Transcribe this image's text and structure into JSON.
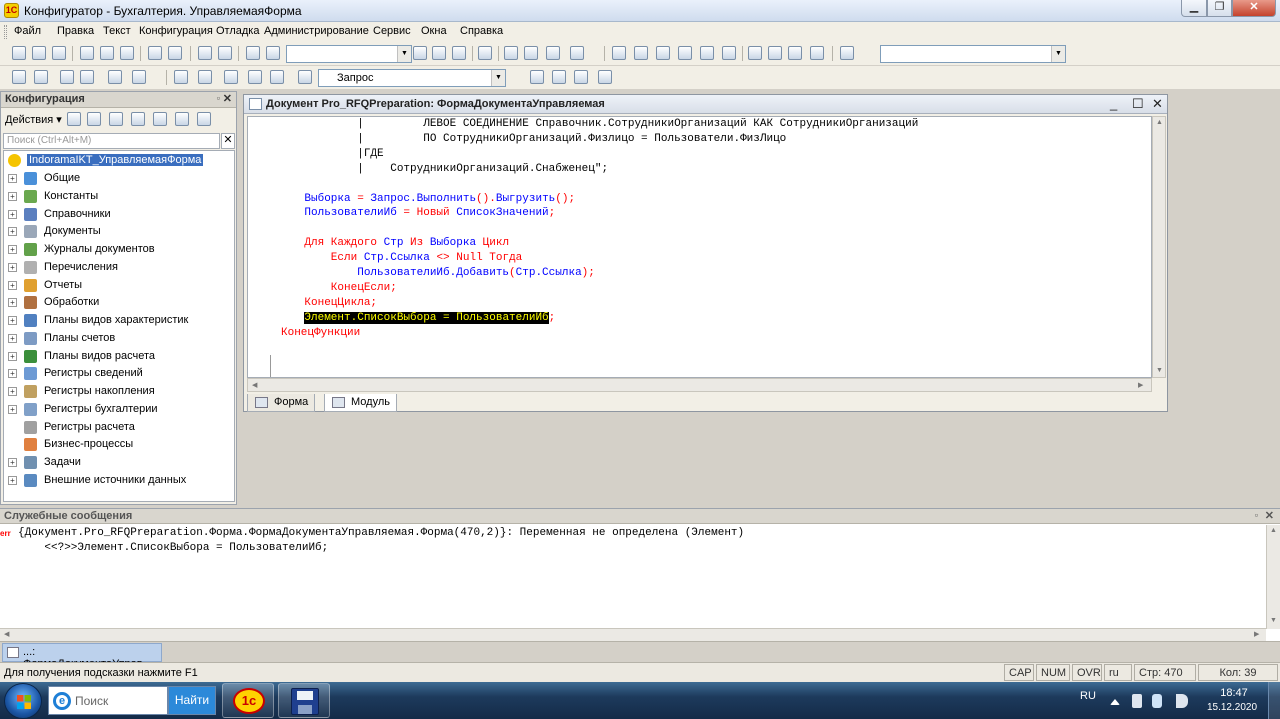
{
  "window": {
    "title": "Конфигуратор - Бухгалтерия. УправляемаяФорма"
  },
  "menu": [
    "Файл",
    "Правка",
    "Текст",
    "Конфигурация",
    "Отладка",
    "Администрирование",
    "Сервис",
    "Окна",
    "Справка"
  ],
  "toolbar": {
    "query_combo": "Запрос"
  },
  "config_panel": {
    "title": "Конфигурация",
    "actions_label": "Действия",
    "search_placeholder": "Поиск (Ctrl+Alt+M)",
    "root": "IndoramaIKT_УправляемаяФорма",
    "items": [
      {
        "label": "Общие",
        "icon": "shapes-icon"
      },
      {
        "label": "Константы",
        "icon": "constants-icon"
      },
      {
        "label": "Справочники",
        "icon": "catalog-icon"
      },
      {
        "label": "Документы",
        "icon": "document-icon"
      },
      {
        "label": "Журналы документов",
        "icon": "journal-icon"
      },
      {
        "label": "Перечисления",
        "icon": "enum-icon"
      },
      {
        "label": "Отчеты",
        "icon": "report-icon"
      },
      {
        "label": "Обработки",
        "icon": "processing-icon"
      },
      {
        "label": "Планы видов характеристик",
        "icon": "chart-types-icon"
      },
      {
        "label": "Планы счетов",
        "icon": "accounts-icon"
      },
      {
        "label": "Планы видов расчета",
        "icon": "calc-types-icon"
      },
      {
        "label": "Регистры сведений",
        "icon": "info-register-icon"
      },
      {
        "label": "Регистры накопления",
        "icon": "accum-register-icon"
      },
      {
        "label": "Регистры бухгалтерии",
        "icon": "acc-register-icon"
      },
      {
        "label": "Регистры расчета",
        "icon": "calc-register-icon"
      },
      {
        "label": "Бизнес-процессы",
        "icon": "business-process-icon"
      },
      {
        "label": "Задачи",
        "icon": "tasks-icon"
      },
      {
        "label": "Внешние источники данных",
        "icon": "external-data-icon"
      }
    ]
  },
  "editor": {
    "title": "Документ Pro_RFQPreparation: ФормаДокументаУправляемая",
    "tabs": [
      "Форма",
      "Модуль"
    ],
    "code_lines": [
      {
        "parts": [
          [
            "tx",
            "            |         ЛЕВОЕ СОЕДИНЕНИЕ Справочник.СотрудникиОрганизаций КАК СотрудникиОрганизаций"
          ]
        ]
      },
      {
        "parts": [
          [
            "tx",
            "            |         ПО СотрудникиОрганизаций.Физлицо = Пользователи.ФизЛицо"
          ]
        ]
      },
      {
        "parts": [
          [
            "tx",
            "            |ГДЕ"
          ]
        ]
      },
      {
        "parts": [
          [
            "tx",
            "            |    СотрудникиОрганизаций.Снабженец\";"
          ]
        ]
      },
      {
        "parts": [
          [
            "tx",
            ""
          ]
        ]
      },
      {
        "parts": [
          [
            "id",
            "    Выборка "
          ],
          [
            "op",
            "= "
          ],
          [
            "id",
            "Запрос.Выполнить"
          ],
          [
            "op",
            "()."
          ],
          [
            "id",
            "Выгрузить"
          ],
          [
            "op",
            "();"
          ]
        ]
      },
      {
        "parts": [
          [
            "id",
            "    ПользователиИб "
          ],
          [
            "op",
            "= "
          ],
          [
            "kw",
            "Новый "
          ],
          [
            "id",
            "СписокЗначений"
          ],
          [
            "op",
            ";"
          ]
        ]
      },
      {
        "parts": [
          [
            "tx",
            ""
          ]
        ]
      },
      {
        "parts": [
          [
            "kw",
            "    Для Каждого "
          ],
          [
            "id",
            "Стр "
          ],
          [
            "kw",
            "Из "
          ],
          [
            "id",
            "Выборка "
          ],
          [
            "kw",
            "Цикл"
          ]
        ]
      },
      {
        "parts": [
          [
            "kw",
            "        Если "
          ],
          [
            "id",
            "Стр.Ссылка "
          ],
          [
            "op",
            "<> "
          ],
          [
            "kw",
            "Null Тогда"
          ]
        ]
      },
      {
        "parts": [
          [
            "id",
            "            ПользователиИб.Добавить"
          ],
          [
            "op",
            "("
          ],
          [
            "id",
            "Стр.Ссылка"
          ],
          [
            "op",
            ");"
          ]
        ]
      },
      {
        "parts": [
          [
            "kw",
            "        КонецЕсли"
          ],
          [
            "op",
            ";"
          ]
        ]
      },
      {
        "parts": [
          [
            "kw",
            "    КонецЦикла"
          ],
          [
            "op",
            ";"
          ]
        ]
      },
      {
        "parts": [
          [
            "tx",
            "    "
          ],
          [
            "hl",
            "Элемент.СписокВыбора = ПользователиИб"
          ],
          [
            "op",
            ";"
          ]
        ]
      },
      {
        "parts": [
          [
            "kw",
            "КонецФункции"
          ]
        ]
      }
    ]
  },
  "messages": {
    "title": "Служебные сообщения",
    "err_tag": "err",
    "line1": "{Документ.Pro_RFQPreparation.Форма.ФормаДокументаУправляемая.Форма(470,2)}: Переменная не определена (Элемент)",
    "line2": "    <<?>>Элемент.СписокВыбора = ПользователиИб;"
  },
  "window_tab": "...: ФормаДокументаУправ...",
  "status": {
    "hint": "Для получения подсказки нажмите F1",
    "cap": "CAP",
    "num": "NUM",
    "ovr": "OVR",
    "lang": "ru",
    "line": "Стр: 470",
    "col": "Кол: 39"
  },
  "taskbar": {
    "search_placeholder": "Поиск",
    "search_button": "Найти",
    "tray_lang": "RU",
    "time": "18:47",
    "date": "15.12.2020"
  }
}
